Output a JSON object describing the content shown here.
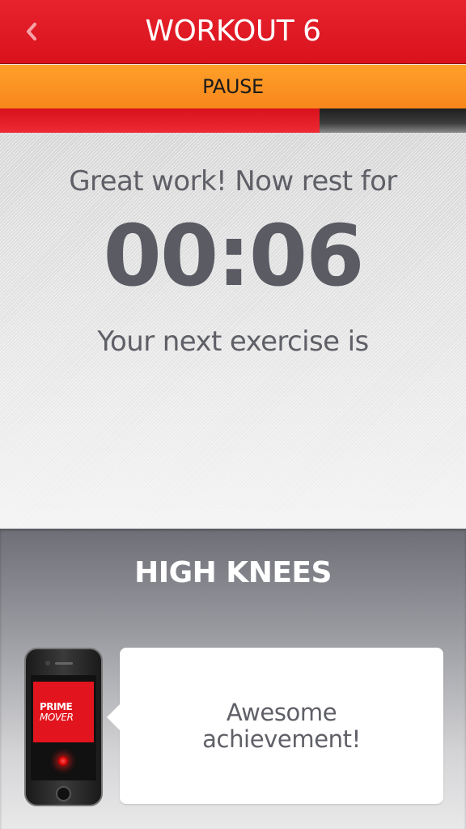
{
  "header": {
    "title": "WORKOUT 6",
    "back_icon": "chevron-left-icon"
  },
  "controls": {
    "pause_label": "PAUSE"
  },
  "progress": {
    "fraction": 0.686
  },
  "rest": {
    "message": "Great work! Now rest for",
    "timer": "00:06",
    "next_message": "Your next exercise is"
  },
  "next_exercise": {
    "name": "HIGH KNEES"
  },
  "coach": {
    "logo_line_1": "PRIME",
    "logo_line_2": "MOVER",
    "message": "Awesome achievement!"
  },
  "colors": {
    "header_red": "#e8232e",
    "pause_orange": "#f7861b",
    "text_gray": "#5f6067"
  }
}
